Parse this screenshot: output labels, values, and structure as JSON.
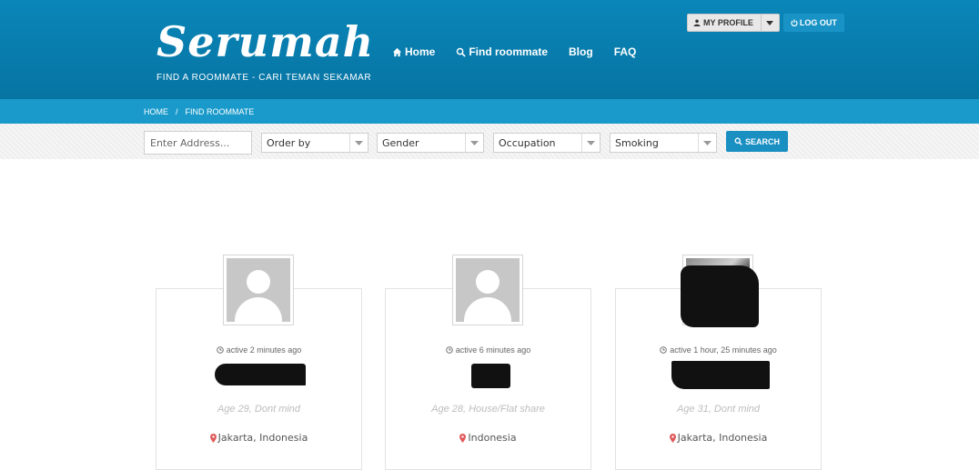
{
  "header": {
    "logo": "Serumah",
    "tagline": "FIND A ROOMMATE - CARI TEMAN SEKAMAR",
    "nav": [
      {
        "label": "Home",
        "icon": "home-icon"
      },
      {
        "label": "Find roommate",
        "icon": "search-icon"
      },
      {
        "label": "Blog"
      },
      {
        "label": "FAQ"
      }
    ],
    "profile_label": "MY PROFILE",
    "logout_label": "LOG OUT"
  },
  "breadcrumb": [
    "HOME",
    "/",
    "FIND ROOMMATE"
  ],
  "filters": {
    "address_placeholder": "Enter Address...",
    "order_by": "Order by",
    "gender": "Gender",
    "occupation": "Occupation",
    "smoking": "Smoking",
    "search_label": "SEARCH"
  },
  "cards": [
    {
      "active": "active 2 minutes ago",
      "meta": "Age 29, Dont mind",
      "location": "Jakarta, Indonesia"
    },
    {
      "active": "active 6 minutes ago",
      "meta": "Age 28, House/Flat share",
      "location": "Indonesia"
    },
    {
      "active": "active 1 hour, 25 minutes ago",
      "meta": "Age 31, Dont mind",
      "location": "Jakarta, Indonesia"
    }
  ],
  "colors": {
    "header_blue": "#0a7fb1",
    "breadcrumb_blue": "#1a9acb",
    "button_blue": "#1a8fc2",
    "pin_red": "#e05a5a"
  }
}
